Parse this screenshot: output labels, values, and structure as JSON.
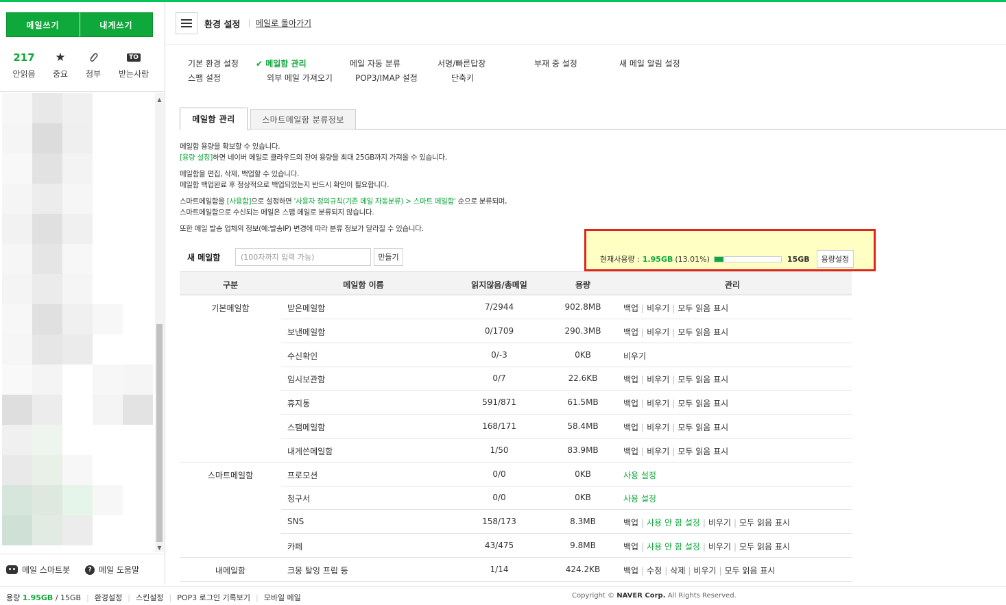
{
  "sidebar": {
    "write_mail": "메일쓰기",
    "write_self": "내게쓰기",
    "unread_count": "217",
    "unread_label": "안읽음",
    "important_label": "중요",
    "attach_label": "첨부",
    "to_badge": "TO",
    "to_label": "받는사람",
    "smartbot": "메일 스마트봇",
    "help": "메일 도움말"
  },
  "header": {
    "title": "환경 설정",
    "back_link": "메일로 돌아가기"
  },
  "settings_nav": {
    "basic": "기본 환경 설정",
    "mailbox": "메일함 관리",
    "auto_sort": "메일 자동 분류",
    "signature": "서명/빠른답장",
    "away": "부재 중 설정",
    "alert": "새 메일 알림 설정",
    "spam": "스팸 설정",
    "external": "외부 메일 가져오기",
    "pop3": "POP3/IMAP 설정",
    "shortcut": "단축키"
  },
  "tabs": {
    "active": "메일함 관리",
    "smart": "스마트메일함 분류정보"
  },
  "info": {
    "l1": "메일함 용량을 확보할 수 있습니다.",
    "l2_link": "[용량 설정]",
    "l2_rest": "하면 네이버 메일로 클라우드의 잔여 용량을 최대 25GB까지 가져올 수 있습니다.",
    "l3": "메일함을 편집, 삭제, 백업할 수 있습니다.",
    "l4": "메일함 백업완료 후 정상적으로 백업되었는지 반드시 확인이 필요합니다.",
    "l5_a": "스마트메일함을 ",
    "l5_b": "[사용함]",
    "l5_c": "으로 설정하면 ",
    "l5_d": "'사용자 정의규칙(기존 메일 자동분류) > 스마트 메일함'",
    "l5_e": " 순으로 분류되며,",
    "l6": "스마트메일함으로 수신되는 메일은 스팸 메일로 분류되지 않습니다.",
    "l7": "또한 메일 발송 업체의 정보(예:발송IP) 변경에 따라 분류 정보가 달라질 수 있습니다."
  },
  "new_mailbox": {
    "label": "새 메일함",
    "placeholder": "(100자까지 입력 가능)",
    "create": "만들기"
  },
  "capacity": {
    "label": "현재사용량 :",
    "used": "1.95GB",
    "percent": "(13.01%)",
    "ratio": 0.1301,
    "total": "15GB",
    "button": "용량설정"
  },
  "table": {
    "headers": [
      "구분",
      "메일함 이름",
      "읽지않음/총메일",
      "용량",
      "관리"
    ],
    "rows": [
      {
        "group": "기본메일함",
        "name": "받은메일함",
        "count": "7/2944",
        "size": "902.8MB",
        "actions": [
          "백업",
          "비우기",
          "모두 읽음 표시"
        ],
        "green": []
      },
      {
        "group": "",
        "name": "보낸메일함",
        "count": "0/1709",
        "size": "290.3MB",
        "actions": [
          "백업",
          "비우기",
          "모두 읽음 표시"
        ],
        "green": []
      },
      {
        "group": "",
        "name": "수신확인",
        "count": "0/-3",
        "size": "0KB",
        "actions": [
          "비우기"
        ],
        "green": []
      },
      {
        "group": "",
        "name": "임시보관함",
        "count": "0/7",
        "size": "22.6KB",
        "actions": [
          "백업",
          "비우기",
          "모두 읽음 표시"
        ],
        "green": []
      },
      {
        "group": "",
        "name": "휴지통",
        "count": "591/871",
        "size": "61.5MB",
        "actions": [
          "백업",
          "비우기",
          "모두 읽음 표시"
        ],
        "green": []
      },
      {
        "group": "",
        "name": "스팸메일함",
        "count": "168/171",
        "size": "58.4MB",
        "actions": [
          "백업",
          "비우기",
          "모두 읽음 표시"
        ],
        "green": []
      },
      {
        "group": "",
        "name": "내게쓴메일함",
        "count": "1/50",
        "size": "83.9MB",
        "actions": [
          "백업",
          "비우기",
          "모두 읽음 표시"
        ],
        "green": []
      },
      {
        "group": "스마트메일함",
        "name": "프로모션",
        "count": "0/0",
        "size": "0KB",
        "actions": [
          "사용 설정"
        ],
        "green": [
          0
        ]
      },
      {
        "group": "",
        "name": "청구서",
        "count": "0/0",
        "size": "0KB",
        "actions": [
          "사용 설정"
        ],
        "green": [
          0
        ]
      },
      {
        "group": "",
        "name": "SNS",
        "count": "158/173",
        "size": "8.3MB",
        "actions": [
          "백업",
          "사용 안 함 설정",
          "비우기",
          "모두 읽음 표시"
        ],
        "green": [
          1
        ]
      },
      {
        "group": "",
        "name": "카페",
        "count": "43/475",
        "size": "9.8MB",
        "actions": [
          "백업",
          "사용 안 함 설정",
          "비우기",
          "모두 읽음 표시"
        ],
        "green": [
          1
        ]
      },
      {
        "group": "내메일함",
        "name": "크몽 탈잉 프립 등",
        "count": "1/14",
        "size": "424.2KB",
        "actions": [
          "백업",
          "수정",
          "삭제",
          "비우기",
          "모두 읽음 표시"
        ],
        "green": []
      }
    ]
  },
  "footer": {
    "quota_label": "용량",
    "quota_used": "1.95GB",
    "quota_total": "/ 15GB",
    "links": [
      "환경설정",
      "스킨설정",
      "POP3 로그인 기록보기",
      "모바일 메일"
    ],
    "copy_prefix": "Copyright ©",
    "copy_brand": "NAVER Corp.",
    "copy_suffix": "All Rights Reserved."
  },
  "colors": {
    "accent": "#0fa83a",
    "highlight_border": "#e0261b",
    "highlight_bg": "#ffffc4"
  }
}
